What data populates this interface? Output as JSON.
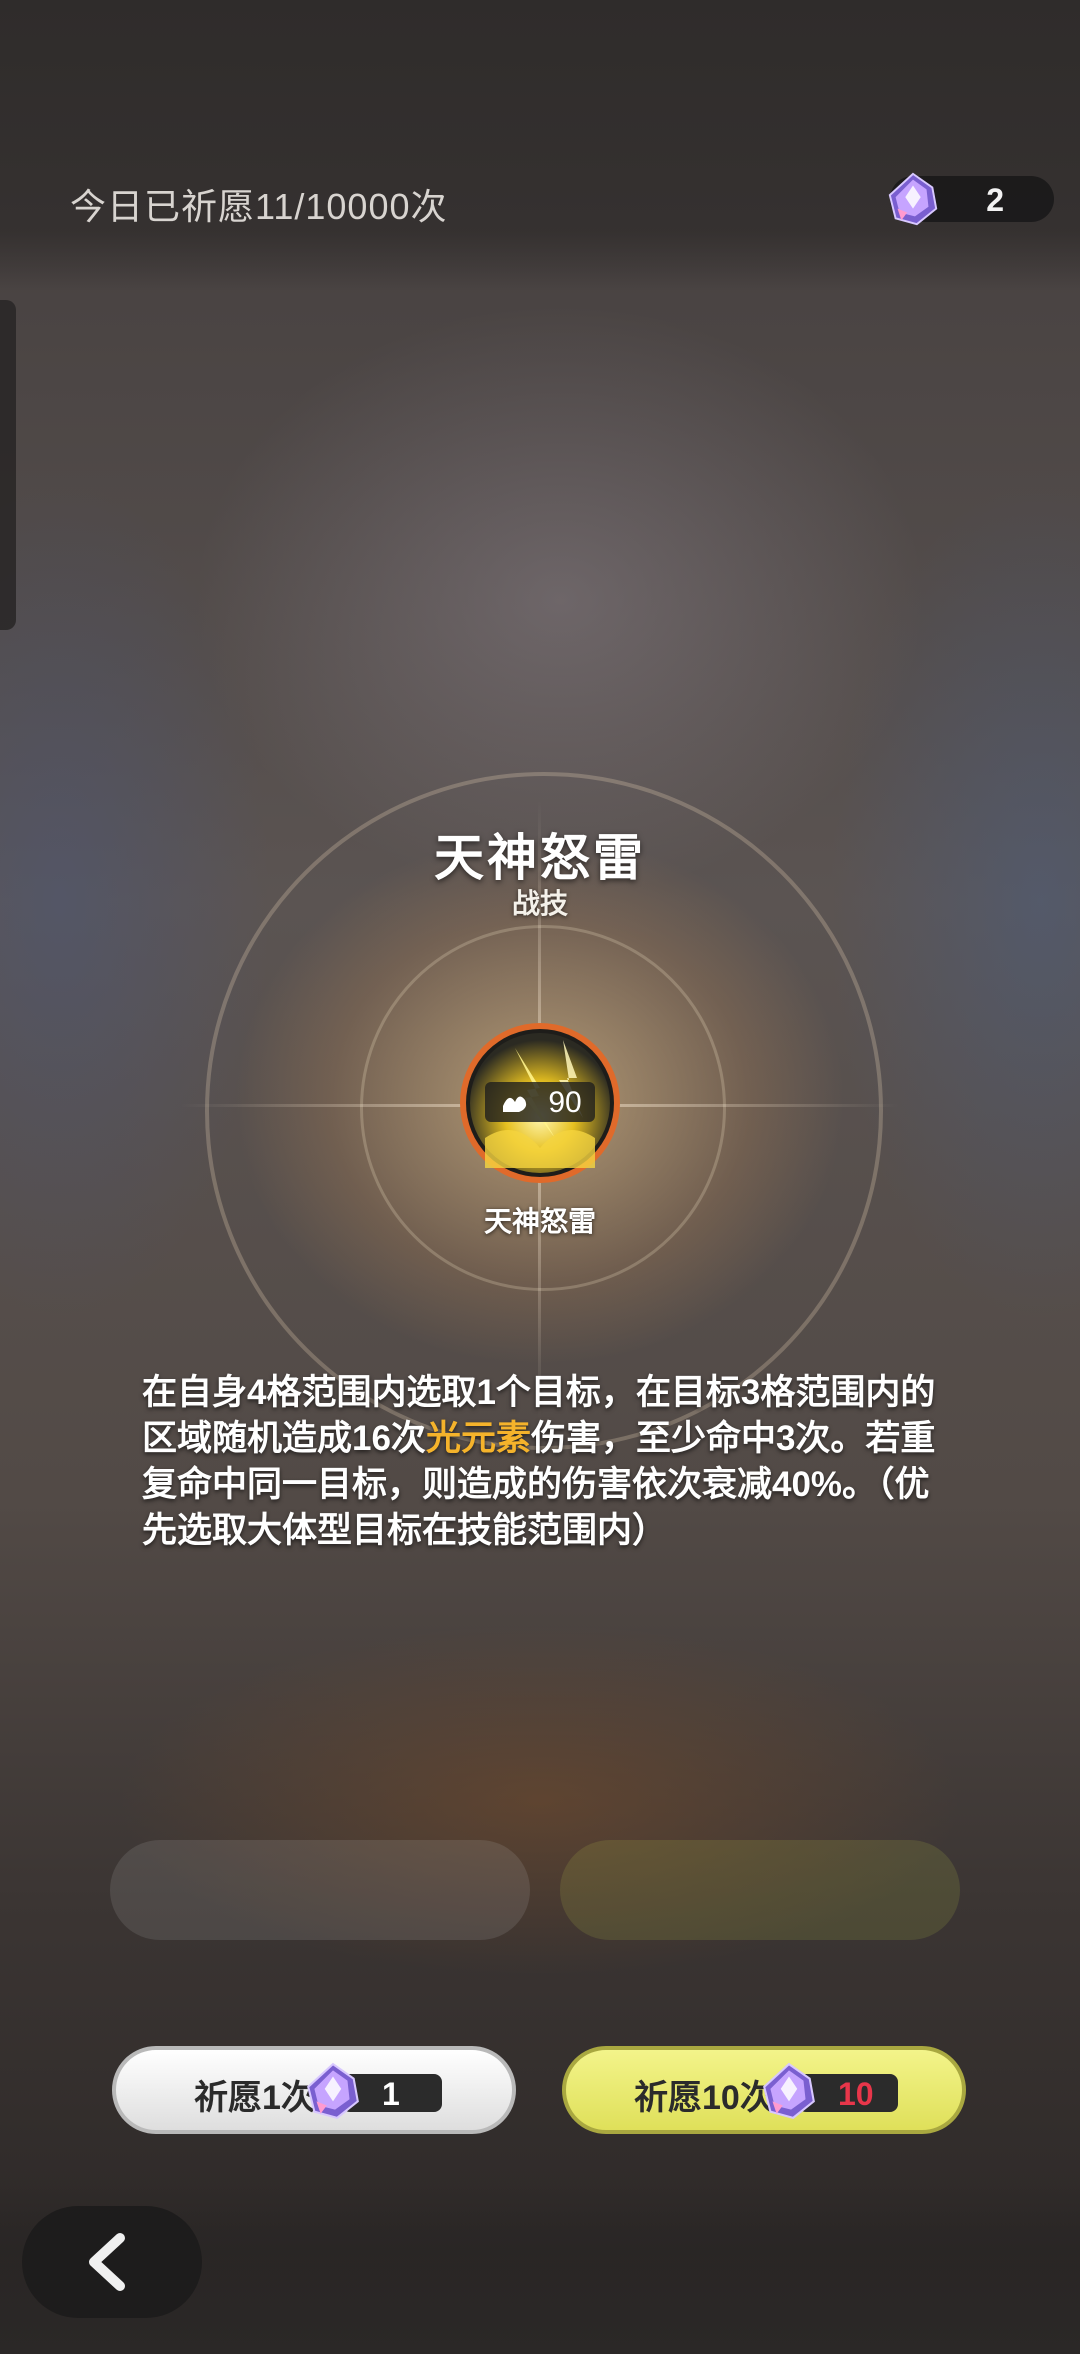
{
  "header": {
    "daily_count": "今日已祈愿11/10000次",
    "currency_amount": "2"
  },
  "skill": {
    "title": "天神怒雷",
    "type": "战技",
    "icon_value": "90",
    "name": "天神怒雷",
    "description": {
      "part1": "在自身4格范围内选取1个目标，在目标3格范围内的区域随机造成16次",
      "highlight": "光元素",
      "part2": "伤害，至少命中3次。若重复命中同一目标，则造成的伤害依次衰减40%。（优先选取大体型目标在技能范围内）"
    }
  },
  "buttons": {
    "single": {
      "label": "祈愿1次",
      "cost": "1"
    },
    "multi": {
      "label": "祈愿10次",
      "cost": "10"
    }
  },
  "colors": {
    "highlight": "#f5b32b",
    "multi_button": "#e4e56a",
    "multi_cost": "#e8364a"
  },
  "icons": [
    "gem-icon",
    "lightning-skill-icon",
    "back-arrow-icon"
  ]
}
